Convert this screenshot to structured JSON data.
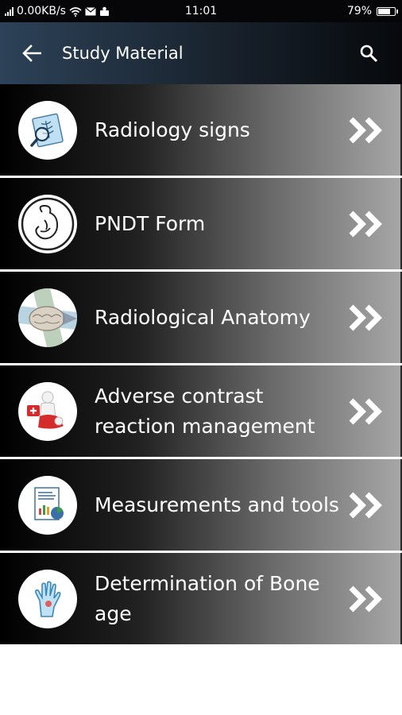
{
  "status_bar": {
    "network_speed": "0.00KB/s",
    "time": "11:01",
    "battery": "79%",
    "battery_level": 0.79
  },
  "header": {
    "title": "Study Material",
    "back_icon": "arrow-left-icon",
    "search_icon": "search-icon"
  },
  "items": [
    {
      "label": "Radiology signs",
      "icon": "xray-magnifier-icon"
    },
    {
      "label": "PNDT Form",
      "icon": "fetus-icon"
    },
    {
      "label": "Radiological Anatomy",
      "icon": "brain-planes-icon"
    },
    {
      "label": "Adverse contrast reaction management",
      "icon": "first-aid-figure-icon"
    },
    {
      "label": "Measurements and tools",
      "icon": "document-chart-icon"
    },
    {
      "label": "Determination of Bone age",
      "icon": "hand-xray-icon"
    }
  ],
  "colors": {
    "app_bar_start": "#2d4258",
    "app_bar_end": "#07090c",
    "status_bar": "#060608",
    "item_dark": "#000000",
    "item_light": "#a6a6a6"
  }
}
